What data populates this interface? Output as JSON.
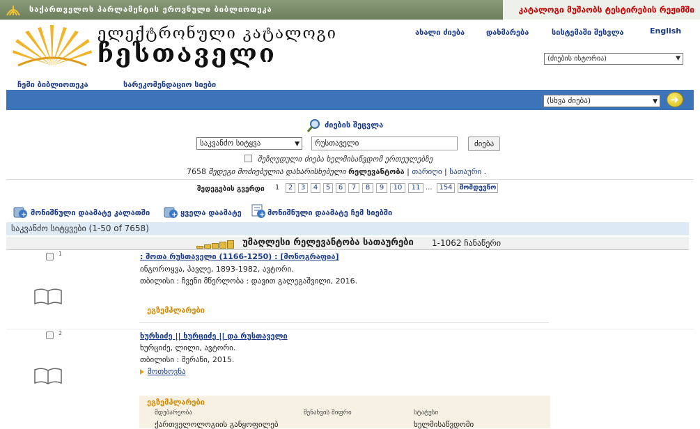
{
  "topbar": {
    "library_name": "საქართველოს პარლამენტის ეროვნული ბიბლიოთეკა",
    "mode": "კატალოგი მუშაობს ტესტირების რეჟიმში"
  },
  "header": {
    "title_line1": "ელექტრონული კატალოგი",
    "title_line2": "ჩესთაველი",
    "links": [
      "ახალი ძიება",
      "დახმარება",
      "სისტემაში შესვლა",
      "English"
    ],
    "history_select": "(ძიების ისტორია)"
  },
  "subnav": [
    "ჩემი ბიბლიოთეკა",
    "სარეკომენდაციო სიები"
  ],
  "bluebar": {
    "other_search": "(სხვა ძიება)"
  },
  "search": {
    "modify_label": "ძიების შეცვლა",
    "field": "საკვანძო სიტყვა",
    "query": "რუსთაველი",
    "button": "ძიება",
    "limit_label": "შეზღუდული ძიება ხელმისაწვდომ ერთეულებზე",
    "summary_count": "7658",
    "summary_text": "შედეგი მოძიებულია დახარისხებული",
    "summary_sort": "რელევანტობა",
    "sort_date": "თარიღი",
    "sort_title": "სათაური"
  },
  "pagination": {
    "label": "შედეგების გვერდი",
    "pages": [
      "1",
      "2",
      "3",
      "4",
      "5",
      "6",
      "7",
      "8",
      "9",
      "10",
      "11"
    ],
    "dots": "...",
    "last": "154",
    "next": "მომდევნო"
  },
  "actions": [
    "მონიშნული დაამატე კალათში",
    "ყველა დაამატე",
    "მონიშნული დაამატე ჩემ სიებში"
  ],
  "results_header": "საკვანძო სიტყვები (1-50 of 7658)",
  "sort_bar": {
    "label": "უმაღლესი რელევანტობა სათაურები",
    "count": "1-1062 ჩანაწერი"
  },
  "records": [
    {
      "num": "1",
      "title": ": შოთა რუსთაველი (1166-1250) : [მონოგრაფია]",
      "author": "ინგოროყვა, პავლე, 1893-1982, ავტორი.",
      "publication": "თბილისი : ჩვენი მწერლობა : დავით გალეგაშვილი, 2016.",
      "copies": "ეგზემპლარები"
    },
    {
      "num": "2",
      "title": "ხურსიძე || ხურციძე || და რუსთაველი",
      "author": "ხურციძე, ლილი, ავტორი.",
      "publication": "თბილისი : მერანი, 2015.",
      "more": "მოთხოვნა",
      "copies": "ეგზემპლარები",
      "table_headers": [
        "მდებარეობა",
        "შენახვის შიფრი",
        "სტატუსი"
      ],
      "table_row": [
        "ქართველოლოგიის განყოფილებ",
        "",
        "ხელმისაწვდომი"
      ]
    }
  ],
  "colors": {
    "topbar": "#7a8a6a",
    "accent_blue": "#3d73b9",
    "link": "#1a3a8a",
    "copies": "#d48a00",
    "mode_red": "#c40000"
  }
}
